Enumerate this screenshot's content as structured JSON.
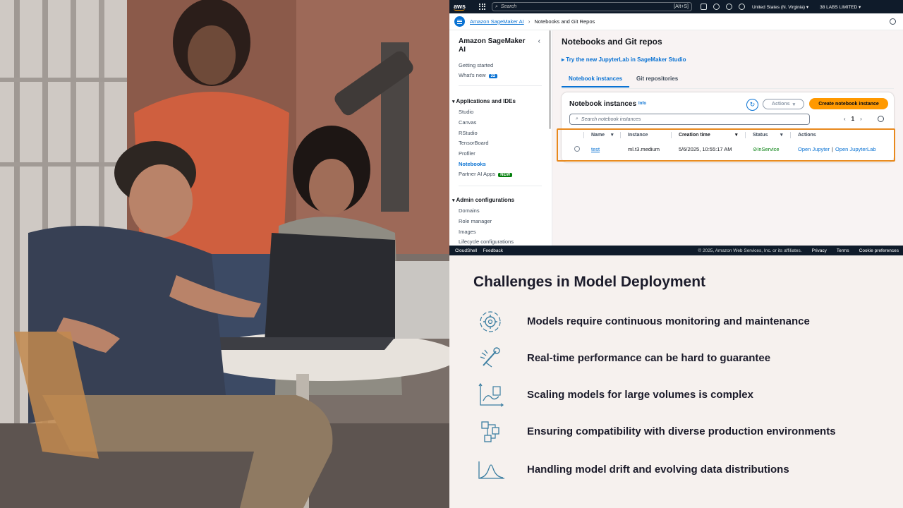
{
  "console": {
    "aws_logo": "aws",
    "search_placeholder": "Search",
    "search_shortcut": "[Alt+S]",
    "region": "United States (N. Virginia) ▾",
    "account": "38 LABS LIMITED ▾",
    "breadcrumb": {
      "parent": "Amazon SageMaker AI",
      "current": "Notebooks and Git Repos"
    },
    "sidenav": {
      "title": "Amazon SageMaker AI",
      "items_top": [
        {
          "label": "Getting started"
        },
        {
          "label": "What's new",
          "badge": "32"
        }
      ],
      "section_apps": "Applications and IDEs",
      "items_apps": [
        {
          "label": "Studio"
        },
        {
          "label": "Canvas"
        },
        {
          "label": "RStudio"
        },
        {
          "label": "TensorBoard"
        },
        {
          "label": "Profiler"
        },
        {
          "label": "Notebooks",
          "active": true
        },
        {
          "label": "Partner AI Apps",
          "badge": "NEW"
        }
      ],
      "section_admin": "Admin configurations",
      "items_admin": [
        {
          "label": "Domains"
        },
        {
          "label": "Role manager"
        },
        {
          "label": "Images"
        },
        {
          "label": "Lifecycle configurations"
        }
      ]
    },
    "page_title": "Notebooks and Git repos",
    "try_link": "Try the new JupyterLab in SageMaker Studio",
    "tabs": [
      "Notebook instances",
      "Git repositories"
    ],
    "panel": {
      "title": "Notebook instances",
      "info": "Info",
      "actions_label": "Actions",
      "create_label": "Create notebook instance",
      "search_placeholder": "Search notebook instances",
      "page_number": "1",
      "columns": [
        "Name",
        "Instance",
        "Creation time",
        "Status",
        "Actions"
      ],
      "rows": [
        {
          "name": "test",
          "instance": "ml.t3.medium",
          "creation_time": "5/6/2025, 10:55:17 AM",
          "status": "InService",
          "action_1": "Open Jupyter",
          "action_sep": "|",
          "action_2": "Open JupyterLab"
        }
      ]
    },
    "footer": {
      "cloudshell": "CloudShell",
      "feedback": "Feedback",
      "copyright": "© 2025, Amazon Web Services, Inc. or its affiliates.",
      "links": [
        "Privacy",
        "Terms",
        "Cookie preferences"
      ]
    }
  },
  "slide": {
    "title": "Challenges in Model Deployment",
    "bullets": [
      {
        "icon": "gear-cycle-icon",
        "text": "Models require continuous monitoring and maintenance"
      },
      {
        "icon": "speed-tool-icon",
        "text": "Real-time performance can be hard to guarantee"
      },
      {
        "icon": "scaling-chart-icon",
        "text": "Scaling models for large volumes is complex"
      },
      {
        "icon": "connected-blocks-icon",
        "text": "Ensuring compatibility with diverse production environments"
      },
      {
        "icon": "distribution-curve-icon",
        "text": "Handling model drift and evolving data distributions"
      }
    ]
  },
  "colors": {
    "accent_blue": "#0972d3",
    "aws_orange": "#ff9900",
    "highlight_orange": "#e8891d",
    "status_green": "#037f0c",
    "icon_blue": "#3b7ea1"
  }
}
